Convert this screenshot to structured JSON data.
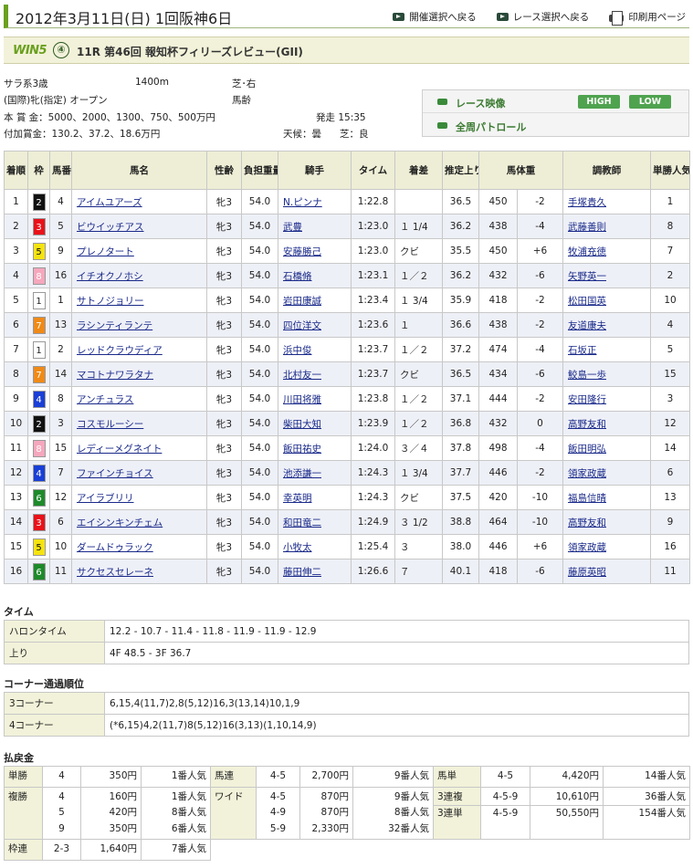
{
  "header": {
    "title": "2012年3月11日(日) 1回阪神6日",
    "links": [
      "開催選択へ戻る",
      "レース選択へ戻る",
      "印刷用ページ"
    ]
  },
  "race": {
    "win5_logo": "WIN5",
    "win5_num": "④",
    "name": "11R 第46回 報知杯フィリーズレビュー(GII)",
    "age": "サラ系3歳",
    "distance": "1400m",
    "surface": "芝･右",
    "condition": "(国際)牝(指定) オープン",
    "weight_type": "馬齢",
    "prize": "本 賞 金：5000、2000、1300、750、500万円",
    "extra_prize": "付加賞金：130.2、37.2、18.6万円",
    "start_time": "発走 15:35",
    "weather": "天候：曇",
    "track": "芝：良"
  },
  "video": {
    "race_video": "レース映像",
    "high": "HIGH",
    "low": "LOW",
    "patrol": "全周パトロール"
  },
  "columns": [
    "着順",
    "枠",
    "馬番",
    "馬名",
    "性齢",
    "負担重量",
    "騎手",
    "タイム",
    "着差",
    "推定上り",
    "馬体重",
    "",
    "調教師",
    "単勝人気"
  ],
  "results": [
    {
      "pos": "1",
      "waku": "2",
      "num": "4",
      "horse": "アイムユアーズ",
      "sex": "牝3",
      "wt": "54.0",
      "jockey": "N.ピンナ",
      "time": "1:22.8",
      "margin": "",
      "last3f": "36.5",
      "bw": "450",
      "diff": "-2",
      "trainer": "手塚貴久",
      "pop": "1"
    },
    {
      "pos": "2",
      "waku": "3",
      "num": "5",
      "horse": "ビウイッチアス",
      "sex": "牝3",
      "wt": "54.0",
      "jockey": "武豊",
      "time": "1:23.0",
      "margin": "１ 1/4",
      "last3f": "36.2",
      "bw": "438",
      "diff": "-4",
      "trainer": "武藤善則",
      "pop": "8"
    },
    {
      "pos": "3",
      "waku": "5",
      "num": "9",
      "horse": "プレノタート",
      "sex": "牝3",
      "wt": "54.0",
      "jockey": "安藤勝己",
      "time": "1:23.0",
      "margin": "クビ",
      "last3f": "35.5",
      "bw": "450",
      "diff": "+6",
      "trainer": "牧浦充徳",
      "pop": "7"
    },
    {
      "pos": "4",
      "waku": "8",
      "num": "16",
      "horse": "イチオクノホシ",
      "sex": "牝3",
      "wt": "54.0",
      "jockey": "石橋脩",
      "time": "1:23.1",
      "margin": "１／２",
      "last3f": "36.2",
      "bw": "432",
      "diff": "-6",
      "trainer": "矢野英一",
      "pop": "2"
    },
    {
      "pos": "5",
      "waku": "1",
      "num": "1",
      "horse": "サトノジョリー",
      "sex": "牝3",
      "wt": "54.0",
      "jockey": "岩田康誠",
      "time": "1:23.4",
      "margin": "１ 3/4",
      "last3f": "35.9",
      "bw": "418",
      "diff": "-2",
      "trainer": "松田国英",
      "pop": "10"
    },
    {
      "pos": "6",
      "waku": "7",
      "num": "13",
      "horse": "ラシンティランテ",
      "sex": "牝3",
      "wt": "54.0",
      "jockey": "四位洋文",
      "time": "1:23.6",
      "margin": "１",
      "last3f": "36.6",
      "bw": "438",
      "diff": "-2",
      "trainer": "友道康夫",
      "pop": "4"
    },
    {
      "pos": "7",
      "waku": "1",
      "num": "2",
      "horse": "レッドクラウディア",
      "sex": "牝3",
      "wt": "54.0",
      "jockey": "浜中俊",
      "time": "1:23.7",
      "margin": "１／２",
      "last3f": "37.2",
      "bw": "474",
      "diff": "-4",
      "trainer": "石坂正",
      "pop": "5"
    },
    {
      "pos": "8",
      "waku": "7",
      "num": "14",
      "horse": "マコトナワラタナ",
      "sex": "牝3",
      "wt": "54.0",
      "jockey": "北村友一",
      "time": "1:23.7",
      "margin": "クビ",
      "last3f": "36.5",
      "bw": "434",
      "diff": "-6",
      "trainer": "鮫島一歩",
      "pop": "15"
    },
    {
      "pos": "9",
      "waku": "4",
      "num": "8",
      "horse": "アンチュラス",
      "sex": "牝3",
      "wt": "54.0",
      "jockey": "川田将雅",
      "time": "1:23.8",
      "margin": "１／２",
      "last3f": "37.1",
      "bw": "444",
      "diff": "-2",
      "trainer": "安田隆行",
      "pop": "3"
    },
    {
      "pos": "10",
      "waku": "2",
      "num": "3",
      "horse": "コスモルーシー",
      "sex": "牝3",
      "wt": "54.0",
      "jockey": "柴田大知",
      "time": "1:23.9",
      "margin": "１／２",
      "last3f": "36.8",
      "bw": "432",
      "diff": "0",
      "trainer": "高野友和",
      "pop": "12"
    },
    {
      "pos": "11",
      "waku": "8",
      "num": "15",
      "horse": "レディーメグネイト",
      "sex": "牝3",
      "wt": "54.0",
      "jockey": "飯田祐史",
      "time": "1:24.0",
      "margin": "３／４",
      "last3f": "37.8",
      "bw": "498",
      "diff": "-4",
      "trainer": "飯田明弘",
      "pop": "14"
    },
    {
      "pos": "12",
      "waku": "4",
      "num": "7",
      "horse": "ファインチョイス",
      "sex": "牝3",
      "wt": "54.0",
      "jockey": "池添謙一",
      "time": "1:24.3",
      "margin": "１ 3/4",
      "last3f": "37.7",
      "bw": "446",
      "diff": "-2",
      "trainer": "領家政蔵",
      "pop": "6"
    },
    {
      "pos": "13",
      "waku": "6",
      "num": "12",
      "horse": "アイラブリリ",
      "sex": "牝3",
      "wt": "54.0",
      "jockey": "幸英明",
      "time": "1:24.3",
      "margin": "クビ",
      "last3f": "37.5",
      "bw": "420",
      "diff": "-10",
      "trainer": "福島信晴",
      "pop": "13"
    },
    {
      "pos": "14",
      "waku": "3",
      "num": "6",
      "horse": "エイシンキンチェム",
      "sex": "牝3",
      "wt": "54.0",
      "jockey": "和田竜二",
      "time": "1:24.9",
      "margin": "３ 1/2",
      "last3f": "38.8",
      "bw": "464",
      "diff": "-10",
      "trainer": "高野友和",
      "pop": "9"
    },
    {
      "pos": "15",
      "waku": "5",
      "num": "10",
      "horse": "ダームドゥラック",
      "sex": "牝3",
      "wt": "54.0",
      "jockey": "小牧太",
      "time": "1:25.4",
      "margin": "３",
      "last3f": "38.0",
      "bw": "446",
      "diff": "+6",
      "trainer": "領家政蔵",
      "pop": "16"
    },
    {
      "pos": "16",
      "waku": "6",
      "num": "11",
      "horse": "サクセスセレーネ",
      "sex": "牝3",
      "wt": "54.0",
      "jockey": "藤田伸二",
      "time": "1:26.6",
      "margin": "７",
      "last3f": "40.1",
      "bw": "418",
      "diff": "-6",
      "trainer": "藤原英昭",
      "pop": "11"
    }
  ],
  "time_section": {
    "heading": "タイム",
    "furlong_label": "ハロンタイム",
    "furlong_value": "12.2 - 10.7 - 11.4 - 11.8 - 11.9 - 11.9 - 12.9",
    "last_label": "上り",
    "last_value": "4F 48.5 - 3F 36.7"
  },
  "corner_section": {
    "heading": "コーナー通過順位",
    "c3_label": "3コーナー",
    "c3_value": "6,15,4(11,7)2,8(5,12)16,3(13,14)10,1,9",
    "c4_label": "4コーナー",
    "c4_value": "(*6,15)4,2(11,7)8(5,12)16(3,13)(1,10,14,9)"
  },
  "payout": {
    "heading": "払戻金",
    "tansho": {
      "label": "単勝",
      "nums": [
        "4"
      ],
      "pay": [
        "350円"
      ],
      "pop": [
        "1番人気"
      ]
    },
    "fukusho": {
      "label": "複勝",
      "nums": [
        "4",
        "5",
        "9"
      ],
      "pay": [
        "160円",
        "420円",
        "350円"
      ],
      "pop": [
        "1番人気",
        "8番人気",
        "6番人気"
      ]
    },
    "wakuren": {
      "label": "枠連",
      "nums": [
        "2-3"
      ],
      "pay": [
        "1,640円"
      ],
      "pop": [
        "7番人気"
      ]
    },
    "umaren": {
      "label": "馬連",
      "nums": [
        "4-5"
      ],
      "pay": [
        "2,700円"
      ],
      "pop": [
        "9番人気"
      ]
    },
    "wide": {
      "label": "ワイド",
      "nums": [
        "4-5",
        "4-9",
        "5-9"
      ],
      "pay": [
        "870円",
        "870円",
        "2,330円"
      ],
      "pop": [
        "9番人気",
        "8番人気",
        "32番人気"
      ]
    },
    "umatan": {
      "label": "馬単",
      "nums": [
        "4-5"
      ],
      "pay": [
        "4,420円"
      ],
      "pop": [
        "14番人気"
      ]
    },
    "sanrenpuku": {
      "label": "3連複",
      "nums": [
        "4-5-9"
      ],
      "pay": [
        "10,610円"
      ],
      "pop": [
        "36番人気"
      ]
    },
    "sanrentan": {
      "label": "3連単",
      "nums": [
        "4-5-9"
      ],
      "pay": [
        "50,550円"
      ],
      "pop": [
        "154番人気"
      ]
    }
  },
  "colors": {
    "accent_green": "#6aa01e",
    "header_bg": "#eeeed6",
    "row_alt": "#eef0f7",
    "link": "#1a2a8a"
  }
}
